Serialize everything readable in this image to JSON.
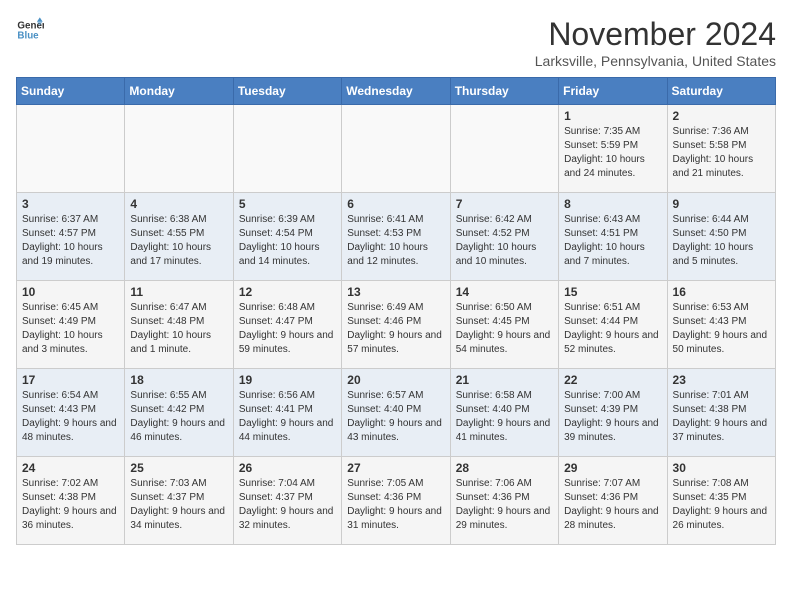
{
  "logo": {
    "line1": "General",
    "line2": "Blue"
  },
  "title": "November 2024",
  "subtitle": "Larksville, Pennsylvania, United States",
  "days_of_week": [
    "Sunday",
    "Monday",
    "Tuesday",
    "Wednesday",
    "Thursday",
    "Friday",
    "Saturday"
  ],
  "weeks": [
    [
      {
        "day": "",
        "info": ""
      },
      {
        "day": "",
        "info": ""
      },
      {
        "day": "",
        "info": ""
      },
      {
        "day": "",
        "info": ""
      },
      {
        "day": "",
        "info": ""
      },
      {
        "day": "1",
        "info": "Sunrise: 7:35 AM\nSunset: 5:59 PM\nDaylight: 10 hours and 24 minutes."
      },
      {
        "day": "2",
        "info": "Sunrise: 7:36 AM\nSunset: 5:58 PM\nDaylight: 10 hours and 21 minutes."
      }
    ],
    [
      {
        "day": "3",
        "info": "Sunrise: 6:37 AM\nSunset: 4:57 PM\nDaylight: 10 hours and 19 minutes."
      },
      {
        "day": "4",
        "info": "Sunrise: 6:38 AM\nSunset: 4:55 PM\nDaylight: 10 hours and 17 minutes."
      },
      {
        "day": "5",
        "info": "Sunrise: 6:39 AM\nSunset: 4:54 PM\nDaylight: 10 hours and 14 minutes."
      },
      {
        "day": "6",
        "info": "Sunrise: 6:41 AM\nSunset: 4:53 PM\nDaylight: 10 hours and 12 minutes."
      },
      {
        "day": "7",
        "info": "Sunrise: 6:42 AM\nSunset: 4:52 PM\nDaylight: 10 hours and 10 minutes."
      },
      {
        "day": "8",
        "info": "Sunrise: 6:43 AM\nSunset: 4:51 PM\nDaylight: 10 hours and 7 minutes."
      },
      {
        "day": "9",
        "info": "Sunrise: 6:44 AM\nSunset: 4:50 PM\nDaylight: 10 hours and 5 minutes."
      }
    ],
    [
      {
        "day": "10",
        "info": "Sunrise: 6:45 AM\nSunset: 4:49 PM\nDaylight: 10 hours and 3 minutes."
      },
      {
        "day": "11",
        "info": "Sunrise: 6:47 AM\nSunset: 4:48 PM\nDaylight: 10 hours and 1 minute."
      },
      {
        "day": "12",
        "info": "Sunrise: 6:48 AM\nSunset: 4:47 PM\nDaylight: 9 hours and 59 minutes."
      },
      {
        "day": "13",
        "info": "Sunrise: 6:49 AM\nSunset: 4:46 PM\nDaylight: 9 hours and 57 minutes."
      },
      {
        "day": "14",
        "info": "Sunrise: 6:50 AM\nSunset: 4:45 PM\nDaylight: 9 hours and 54 minutes."
      },
      {
        "day": "15",
        "info": "Sunrise: 6:51 AM\nSunset: 4:44 PM\nDaylight: 9 hours and 52 minutes."
      },
      {
        "day": "16",
        "info": "Sunrise: 6:53 AM\nSunset: 4:43 PM\nDaylight: 9 hours and 50 minutes."
      }
    ],
    [
      {
        "day": "17",
        "info": "Sunrise: 6:54 AM\nSunset: 4:43 PM\nDaylight: 9 hours and 48 minutes."
      },
      {
        "day": "18",
        "info": "Sunrise: 6:55 AM\nSunset: 4:42 PM\nDaylight: 9 hours and 46 minutes."
      },
      {
        "day": "19",
        "info": "Sunrise: 6:56 AM\nSunset: 4:41 PM\nDaylight: 9 hours and 44 minutes."
      },
      {
        "day": "20",
        "info": "Sunrise: 6:57 AM\nSunset: 4:40 PM\nDaylight: 9 hours and 43 minutes."
      },
      {
        "day": "21",
        "info": "Sunrise: 6:58 AM\nSunset: 4:40 PM\nDaylight: 9 hours and 41 minutes."
      },
      {
        "day": "22",
        "info": "Sunrise: 7:00 AM\nSunset: 4:39 PM\nDaylight: 9 hours and 39 minutes."
      },
      {
        "day": "23",
        "info": "Sunrise: 7:01 AM\nSunset: 4:38 PM\nDaylight: 9 hours and 37 minutes."
      }
    ],
    [
      {
        "day": "24",
        "info": "Sunrise: 7:02 AM\nSunset: 4:38 PM\nDaylight: 9 hours and 36 minutes."
      },
      {
        "day": "25",
        "info": "Sunrise: 7:03 AM\nSunset: 4:37 PM\nDaylight: 9 hours and 34 minutes."
      },
      {
        "day": "26",
        "info": "Sunrise: 7:04 AM\nSunset: 4:37 PM\nDaylight: 9 hours and 32 minutes."
      },
      {
        "day": "27",
        "info": "Sunrise: 7:05 AM\nSunset: 4:36 PM\nDaylight: 9 hours and 31 minutes."
      },
      {
        "day": "28",
        "info": "Sunrise: 7:06 AM\nSunset: 4:36 PM\nDaylight: 9 hours and 29 minutes."
      },
      {
        "day": "29",
        "info": "Sunrise: 7:07 AM\nSunset: 4:36 PM\nDaylight: 9 hours and 28 minutes."
      },
      {
        "day": "30",
        "info": "Sunrise: 7:08 AM\nSunset: 4:35 PM\nDaylight: 9 hours and 26 minutes."
      }
    ]
  ]
}
